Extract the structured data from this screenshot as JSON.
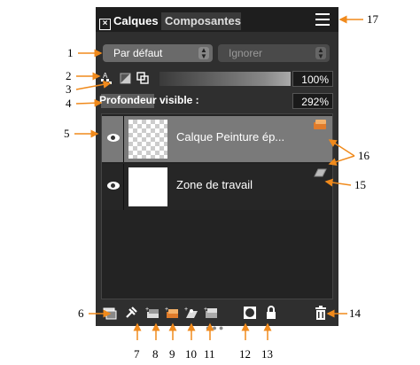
{
  "tabs": {
    "active_label": "Calques",
    "inactive_label": "Composantes"
  },
  "blend_mode": "Par défaut",
  "blend_ignore": "Ignorer",
  "opacity": "100%",
  "depth_label": "Profondeur visible :",
  "depth_value": "292%",
  "layers": [
    {
      "name": "Calque Peinture ép...",
      "selected": true
    },
    {
      "name": "Zone de travail",
      "selected": false
    }
  ],
  "callouts": [
    "1",
    "2",
    "3",
    "4",
    "5",
    "6",
    "7",
    "8",
    "9",
    "10",
    "11",
    "12",
    "13",
    "14",
    "15",
    "16",
    "17"
  ],
  "icons": {
    "tab_close": "close-icon",
    "menu": "hamburger-menu-icon",
    "eye": "eye-icon",
    "paint_layer": "paint-layer-icon",
    "artboard": "artboard-icon",
    "trash": "trash-icon",
    "lock": "lock-icon"
  },
  "colors": {
    "panel_bg": "#2f2f2f",
    "selected_row": "#7a7a7a",
    "paint_badge": "#e07b2a"
  }
}
